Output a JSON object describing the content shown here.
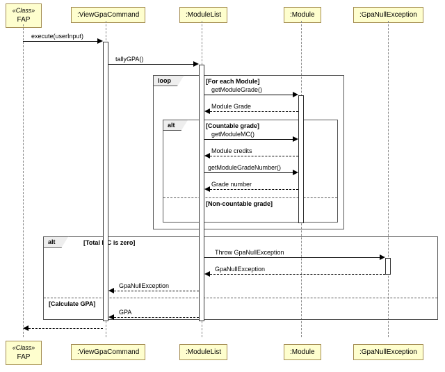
{
  "participants": {
    "fap": {
      "stereotype": "«Class»",
      "name": "FAP"
    },
    "viewGpa": ":ViewGpaCommand",
    "moduleList": ":ModuleList",
    "module": ":Module",
    "gpaNull": ":GpaNullException"
  },
  "messages": {
    "execute": "execute(userInput)",
    "tallyGPA": "tallyGPA()",
    "getModuleGrade": "getModuleGrade()",
    "moduleGrade": "Module Grade",
    "getModuleMC": "getModuleMC()",
    "moduleCredits": "Module credits",
    "getModuleGradeNumber": "getModuleGradeNumber()",
    "gradeNumber": "Grade number",
    "throwGpaNull": "Throw GpaNullException",
    "gpaNullExc1": "GpaNullException",
    "gpaNullExc2": "GpaNullException",
    "gpa": "GPA"
  },
  "frames": {
    "loop": "loop",
    "alt1": "alt",
    "alt2": "alt"
  },
  "guards": {
    "forEachModule": "[For each Module]",
    "countable": "[Countable grade]",
    "nonCountable": "[Non-countable grade]",
    "totalMcZero": "[Total MC is zero]",
    "calculateGpa": "[Calculate GPA]"
  }
}
